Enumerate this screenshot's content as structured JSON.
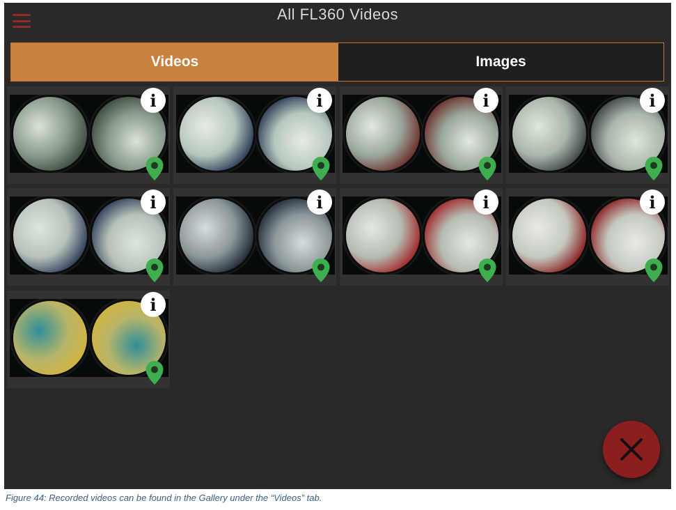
{
  "header": {
    "title": "All FL360 Videos",
    "menu_icon": "hamburger-menu-icon"
  },
  "tabs": [
    {
      "label": "Videos",
      "active": true
    },
    {
      "label": "Images",
      "active": false
    }
  ],
  "videos": [
    {
      "info_icon_text": "i",
      "location_icon": "map-pin-icon"
    },
    {
      "info_icon_text": "i",
      "location_icon": "map-pin-icon"
    },
    {
      "info_icon_text": "i",
      "location_icon": "map-pin-icon"
    },
    {
      "info_icon_text": "i",
      "location_icon": "map-pin-icon"
    },
    {
      "info_icon_text": "i",
      "location_icon": "map-pin-icon"
    },
    {
      "info_icon_text": "i",
      "location_icon": "map-pin-icon"
    },
    {
      "info_icon_text": "i",
      "location_icon": "map-pin-icon"
    },
    {
      "info_icon_text": "i",
      "location_icon": "map-pin-icon"
    },
    {
      "info_icon_text": "i",
      "location_icon": "map-pin-icon"
    }
  ],
  "close_button": {
    "icon": "close-icon"
  },
  "caption": "Figure 44: Recorded videos can be found in the Gallery under the “Videos” tab.",
  "colors": {
    "background": "#2b2829",
    "active_tab": "#c8813e",
    "inactive_tab": "#1f1d1e",
    "pin": "#3fae4f",
    "close_fab": "#8d1e1e"
  }
}
